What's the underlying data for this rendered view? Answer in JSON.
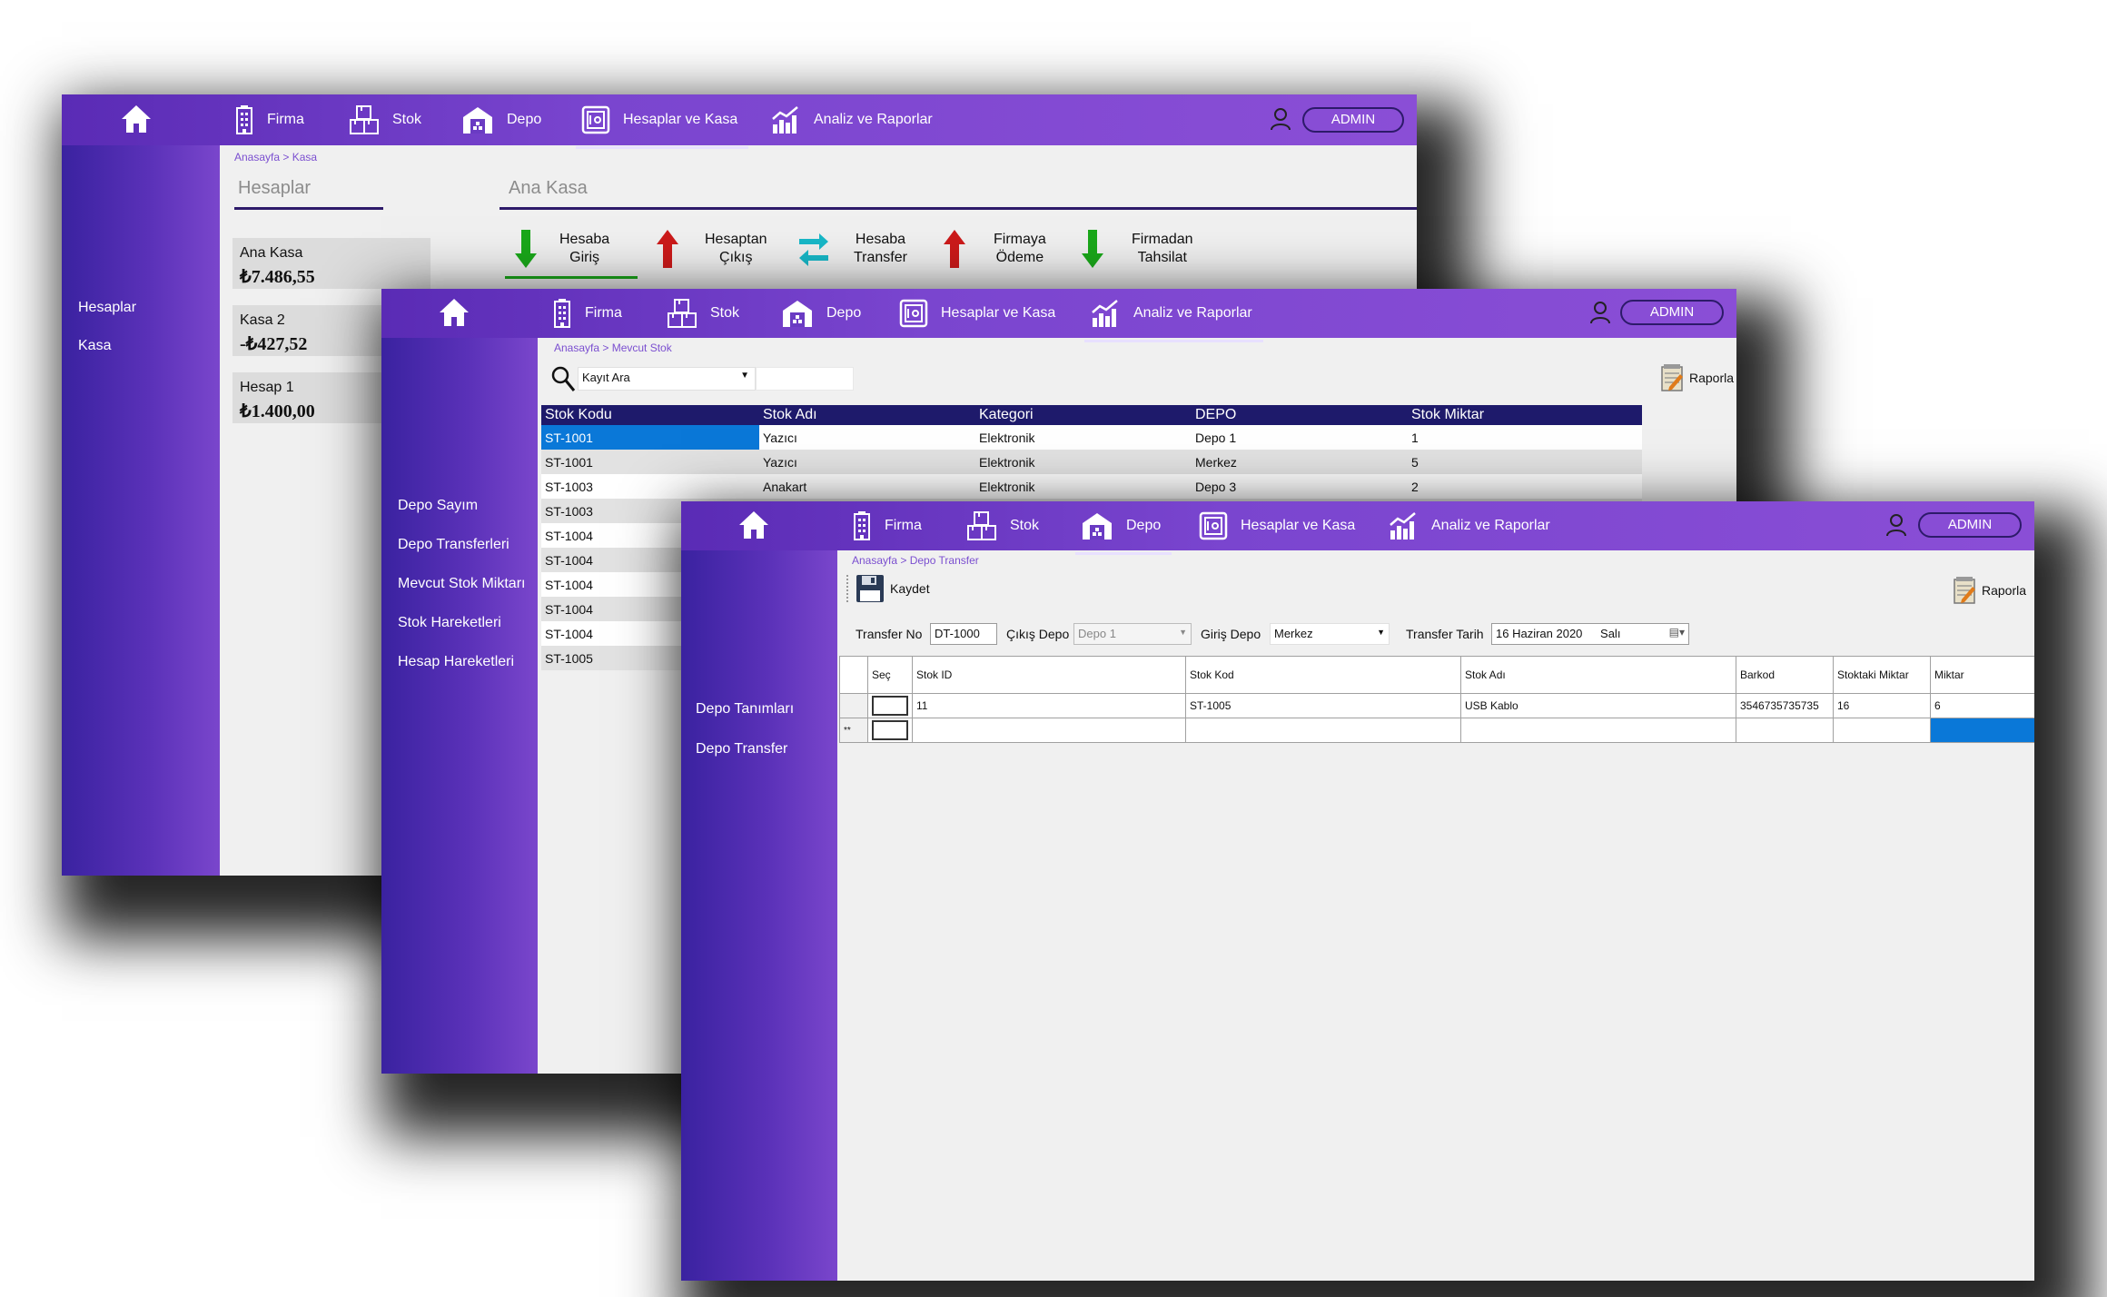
{
  "nav": {
    "items": [
      "Firma",
      "Stok",
      "Depo",
      "Hesaplar ve Kasa",
      "Analiz ve Raporlar"
    ],
    "user": "ADMIN"
  },
  "kasa": {
    "breadcrumb": "Anasayfa > Kasa",
    "sidebar": [
      "Hesaplar",
      "Kasa"
    ],
    "accounts_title": "Hesaplar",
    "main_title": "Ana Kasa",
    "accounts": [
      {
        "name": "Ana Kasa",
        "amount": "₺7.486,55"
      },
      {
        "name": "Kasa 2",
        "amount": "-₺427,52"
      },
      {
        "name": "Hesap 1",
        "amount": "₺1.400,00"
      }
    ],
    "actions": [
      {
        "line1": "Hesaba",
        "line2": "Giriş"
      },
      {
        "line1": "Hesaptan",
        "line2": "Çıkış"
      },
      {
        "line1": "Hesaba",
        "line2": "Transfer"
      },
      {
        "line1": "Firmaya",
        "line2": "Ödeme"
      },
      {
        "line1": "Firmadan",
        "line2": "Tahsilat"
      }
    ]
  },
  "stok": {
    "breadcrumb": "Anasayfa > Mevcut Stok",
    "sidebar": [
      "Depo Sayım",
      "Depo Transferleri",
      "Mevcut Stok Miktarı",
      "Stok Hareketleri",
      "Hesap Hareketleri"
    ],
    "search_label": "Kayıt Ara",
    "report_label": "Raporla",
    "columns": [
      "Stok Kodu",
      "Stok Adı",
      "Kategori",
      "DEPO",
      "Stok Miktar"
    ],
    "rows": [
      [
        "ST-1001",
        "Yazıcı",
        "Elektronik",
        "Depo 1",
        "1"
      ],
      [
        "ST-1001",
        "Yazıcı",
        "Elektronik",
        "Merkez",
        "5"
      ],
      [
        "ST-1003",
        "Anakart",
        "Elektronik",
        "Depo 3",
        "2"
      ],
      [
        "ST-1003",
        "",
        "",
        "",
        ""
      ],
      [
        "ST-1004",
        "",
        "",
        "",
        ""
      ],
      [
        "ST-1004",
        "",
        "",
        "",
        ""
      ],
      [
        "ST-1004",
        "",
        "",
        "",
        ""
      ],
      [
        "ST-1004",
        "",
        "",
        "",
        ""
      ],
      [
        "ST-1004",
        "",
        "",
        "",
        ""
      ],
      [
        "ST-1005",
        "",
        "",
        "",
        ""
      ]
    ]
  },
  "transfer": {
    "breadcrumb": "Anasayfa > Depo Transfer",
    "sidebar": [
      "Depo Tanımları",
      "Depo Transfer"
    ],
    "save_label": "Kaydet",
    "report_label": "Raporla",
    "form": {
      "no_label": "Transfer No",
      "no_value": "DT-1000",
      "out_label": "Çıkış Depo",
      "out_value": "Depo 1",
      "in_label": "Giriş Depo",
      "in_value": "Merkez",
      "date_label": "Transfer Tarih",
      "date_value": "16 Haziran 2020",
      "day_value": "Salı"
    },
    "columns": [
      "Seç",
      "Stok ID",
      "Stok Kod",
      "Stok Adı",
      "Barkod",
      "Stoktaki Miktar",
      "Miktar"
    ],
    "rows": [
      [
        "",
        "11",
        "ST-1005",
        "USB Kablo",
        "3546735735735",
        "16",
        "6"
      ]
    ],
    "new_row_marker": "**"
  }
}
